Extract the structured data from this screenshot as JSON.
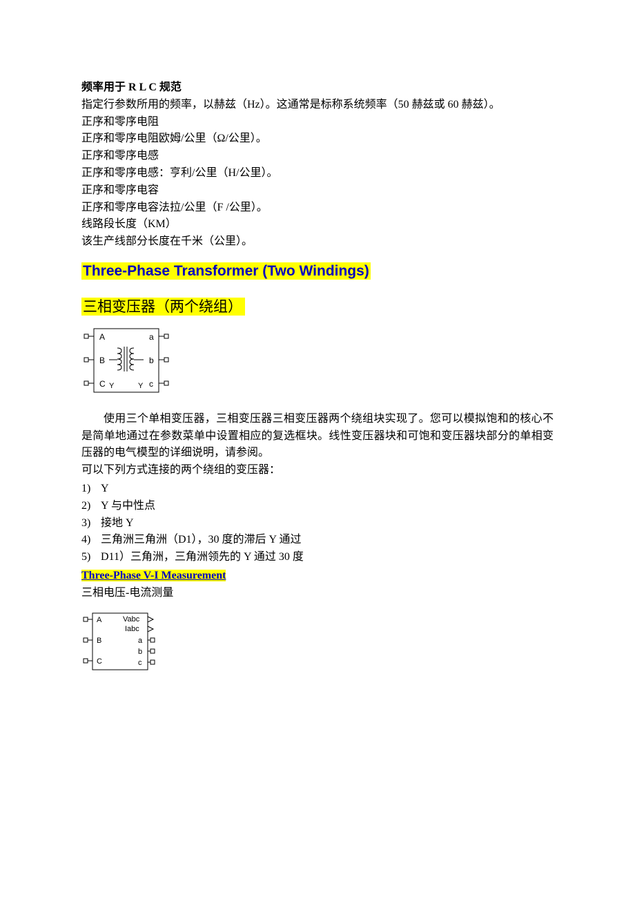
{
  "rlc": {
    "heading": "频率用于 R L C 规范",
    "lines": [
      "指定行参数所用的频率，以赫兹（Hz）。这通常是标称系统频率（50 赫兹或 60 赫兹）。",
      "正序和零序电阻",
      "正序和零序电阻欧姆/公里（Ω/公里）。",
      "正序和零序电感",
      "正序和零序电感：亨利/公里（H/公里）。",
      "正序和零序电容",
      "正序和零序电容法拉/公里（F /公里）。",
      "线路段长度（KM）",
      "该生产线部分长度在千米（公里）。"
    ]
  },
  "transformer": {
    "title_en": "Three-Phase Transformer (Two Windings)",
    "title_cn": "三相变压器（两个绕组）",
    "diagram": {
      "A": "A",
      "a": "a",
      "B": "B",
      "b": "b",
      "C": "C",
      "c": "c",
      "Y1": "Y",
      "Y2": "Y"
    },
    "para1": "使用三个单相变压器，三相变压器三相变压器两个绕组块实现了。您可以模拟饱和的核心不是简单地通过在参数菜单中设置相应的复选框块。线性变压器块和可饱和变压器块部分的单相变压器的电气模型的详细说明，请参阅。",
    "para2": "可以下列方式连接的两个绕组的变压器：",
    "connections": [
      "Y",
      "Y 与中性点",
      "接地 Y",
      "三角洲三角洲（D1），30 度的滞后 Y 通过",
      "D11）三角洲，三角洲领先的 Y 通过 30 度"
    ]
  },
  "measurement": {
    "title_en": "Three-Phase V-I Measurement",
    "title_cn": "三相电压-电流测量",
    "diagram": {
      "A": "A",
      "B": "B",
      "C": "C",
      "Vabc": "Vabc",
      "Iabc": "Iabc",
      "a": "a",
      "b": "b",
      "c": "c"
    }
  }
}
